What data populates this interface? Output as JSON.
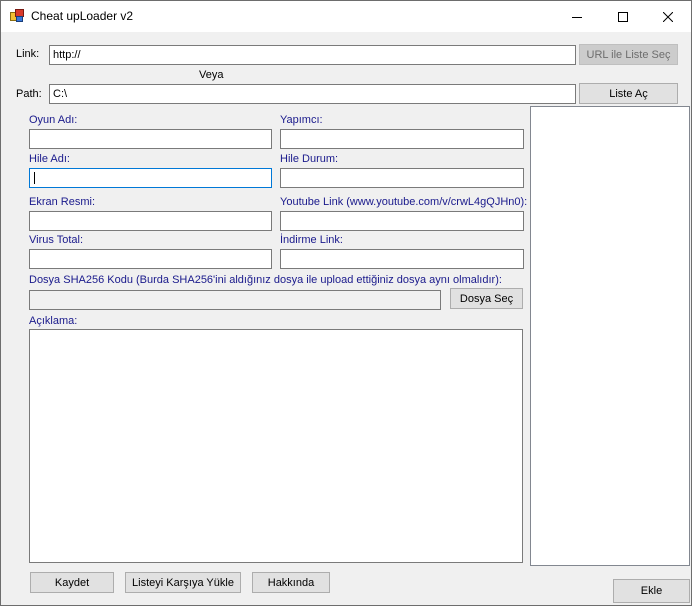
{
  "window": {
    "title": "Cheat upLoader v2",
    "controls": [
      "minimize-icon",
      "maximize-icon",
      "close-icon"
    ]
  },
  "link": {
    "label": "Link:",
    "value": "http://",
    "button": "URL ile Liste Seç",
    "button_enabled": false
  },
  "or_label": "Veya",
  "path": {
    "label": "Path:",
    "value": "C:\\",
    "button": "Liste Aç"
  },
  "form": {
    "game_name": {
      "label": "Oyun Adı:",
      "value": ""
    },
    "maker": {
      "label": "Yapımcı:",
      "value": ""
    },
    "cheat_name": {
      "label": "Hile Adı:",
      "value": ""
    },
    "cheat_status": {
      "label": "Hile Durum:",
      "value": ""
    },
    "screenshot": {
      "label": "Ekran Resmi:",
      "value": ""
    },
    "youtube": {
      "label": "Youtube Link (www.youtube.com/v/crwL4gQJHn0):",
      "value": ""
    },
    "virus_total": {
      "label": "Virus Total:",
      "value": ""
    },
    "download": {
      "label": "İndirme Link:",
      "value": ""
    },
    "sha256": {
      "label": "Dosya SHA256 Kodu (Burda SHA256'ini aldığınız dosya ile upload ettiğiniz dosya aynı olmalıdır):",
      "value": "",
      "button": "Dosya Seç"
    },
    "description": {
      "label": "Açıklama:",
      "value": ""
    }
  },
  "bottom_buttons": {
    "save": "Kaydet",
    "upload_list": "Listeyi Karşıya Yükle",
    "about": "Hakkında"
  },
  "add_button": "Ekle",
  "colors": {
    "label_blue": "#1a1a8c",
    "window_bg": "#f0f0f0",
    "button_bg": "#e1e1e1"
  }
}
